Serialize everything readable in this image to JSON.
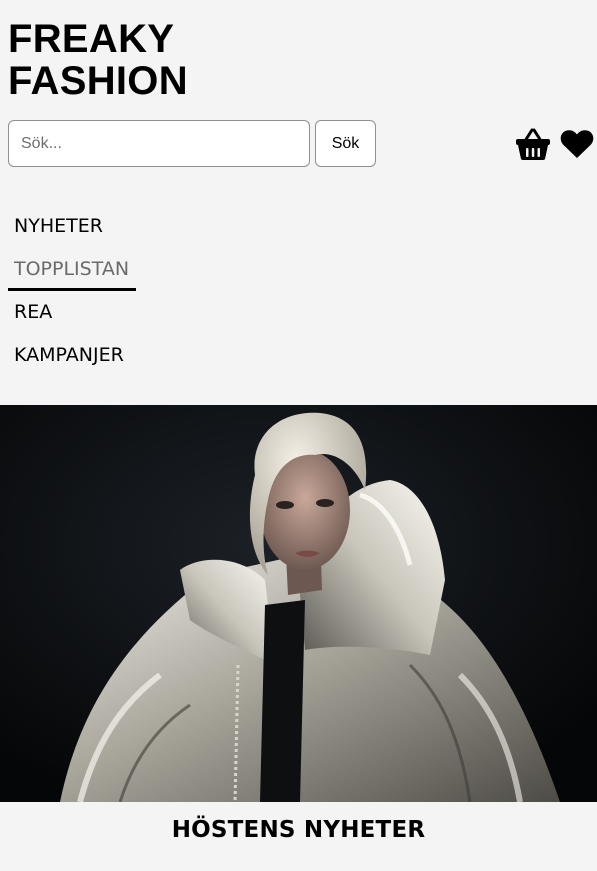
{
  "header": {
    "logo_line1": "FREAKY",
    "logo_line2": "FASHION"
  },
  "search": {
    "placeholder": "Sök...",
    "button_label": "Sök"
  },
  "icons": {
    "basket": "basket-icon",
    "heart": "heart-icon"
  },
  "nav": {
    "items": [
      {
        "label": "NYHETER",
        "active": false
      },
      {
        "label": "TOPPLISTAN",
        "active": true
      },
      {
        "label": "REA",
        "active": false
      },
      {
        "label": "KAMPANJER",
        "active": false
      }
    ]
  },
  "hero": {
    "image": "model-in-silver-puffer-jacket"
  },
  "section": {
    "title": "HÖSTENS NYHETER"
  },
  "colors": {
    "background": "#f4f4f4",
    "active_nav_text": "#6a6a6a",
    "hero_background": "#0b0c0e"
  }
}
